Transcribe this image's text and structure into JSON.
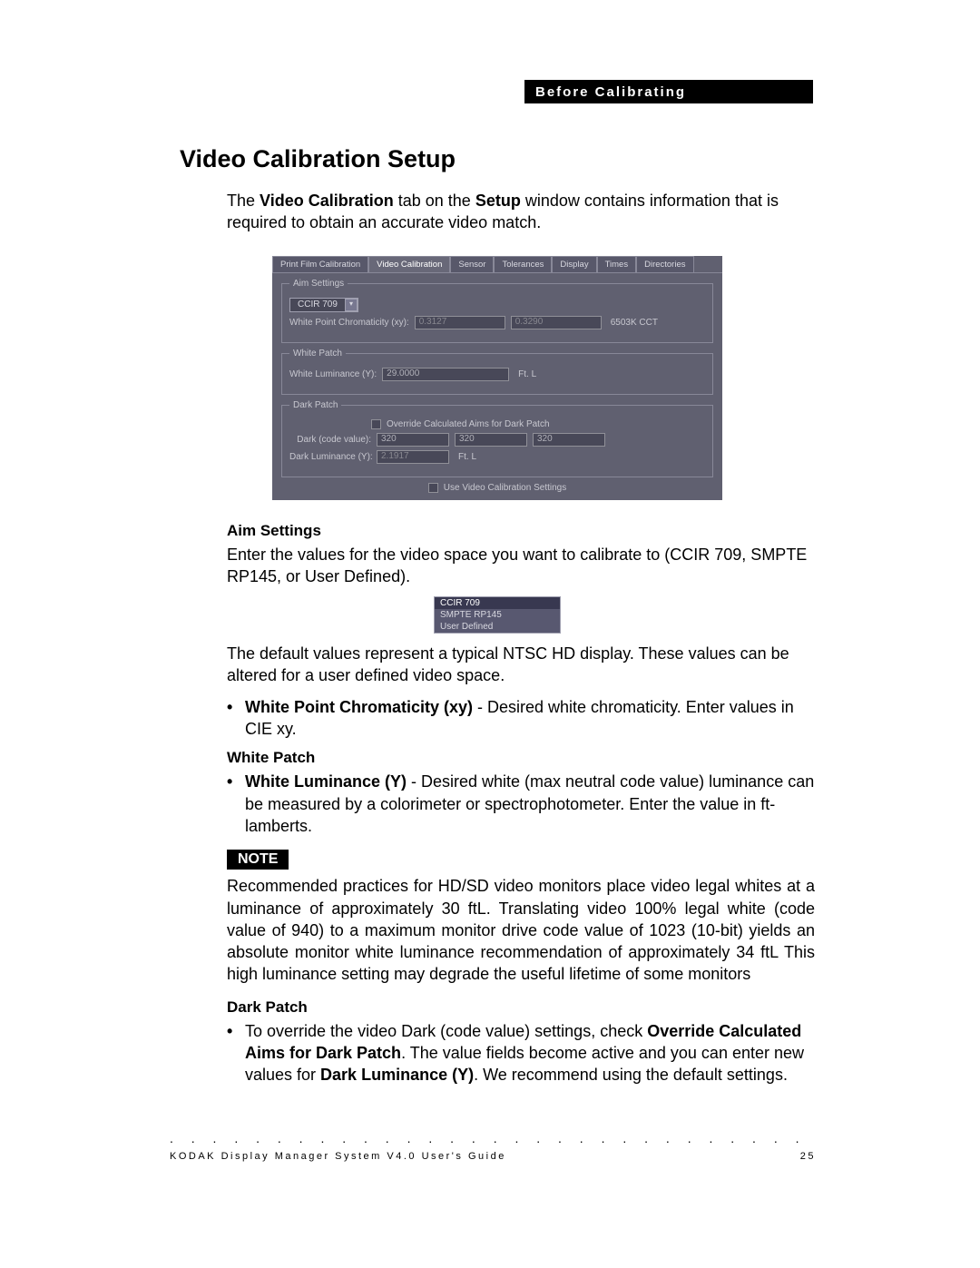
{
  "header": {
    "chapter": "Before Calibrating"
  },
  "title": "Video Calibration Setup",
  "intro": {
    "pre": "The ",
    "bold1": "Video Calibration",
    "mid": " tab on the ",
    "bold2": "Setup",
    "post": " window contains information that is required to obtain an accurate video match."
  },
  "panel": {
    "tabs": [
      "Print Film Calibration",
      "Video Calibration",
      "Sensor",
      "Tolerances",
      "Display",
      "Times",
      "Directories"
    ],
    "active_tab": 1,
    "aim": {
      "legend": "Aim Settings",
      "preset": "CCIR 709",
      "wpc_label": "White Point Chromaticity (xy):",
      "wpc_x": "0.3127",
      "wpc_y": "0.3290",
      "cct": "6503K CCT"
    },
    "white": {
      "legend": "White Patch",
      "wl_label": "White Luminance (Y):",
      "wl_value": "29.0000",
      "unit": "Ft. L"
    },
    "dark": {
      "legend": "Dark Patch",
      "override_label": "Override Calculated Aims for Dark Patch",
      "code_label": "Dark (code value):",
      "code_vals": [
        "320",
        "320",
        "320"
      ],
      "dl_label": "Dark Luminance (Y):",
      "dl_value": "2.1917",
      "unit": "Ft. L"
    },
    "use_settings": "Use Video Calibration Settings"
  },
  "aim_section": {
    "heading": "Aim Settings",
    "p1": "Enter the values for the video space you want to calibrate to (CCIR 709, SMPTE RP145, or User Defined).",
    "options": [
      "CCIR 709",
      "SMPTE RP145",
      "User Defined"
    ],
    "p2": "The default values represent a typical NTSC HD display. These values can be altered for a user defined video space.",
    "bullet_bold": "White Point Chromaticity (xy)",
    "bullet_rest": " - Desired white chromaticity. Enter values in CIE xy."
  },
  "white_section": {
    "heading": "White Patch",
    "bullet_bold": "White Luminance (Y)",
    "bullet_rest": " - Desired white (max neutral code value) luminance can be measured by a colorimeter or spectrophotometer. Enter the value in ft-lamberts."
  },
  "note": {
    "label": "NOTE",
    "text": "Recommended practices for HD/SD video monitors place video legal whites at a luminance of approximately 30 ftL. Translating video 100% legal white (code value of 940) to a maximum monitor drive code value of 1023 (10-bit) yields an absolute monitor white luminance recommendation of approximately 34 ftL This high luminance setting may degrade the useful lifetime of some monitors"
  },
  "dark_section": {
    "heading": "Dark Patch",
    "bullet": {
      "pre": "To override the video Dark (code value) settings, check ",
      "b1": "Override Calculated Aims for Dark Patch",
      "mid": ". The value fields become active and you can enter new values for ",
      "b2": "Dark Luminance (Y)",
      "post": ". We recommend using the default settings."
    }
  },
  "footer": {
    "left": "KODAK Display Manager System V4.0 User's Guide",
    "right": "25"
  }
}
